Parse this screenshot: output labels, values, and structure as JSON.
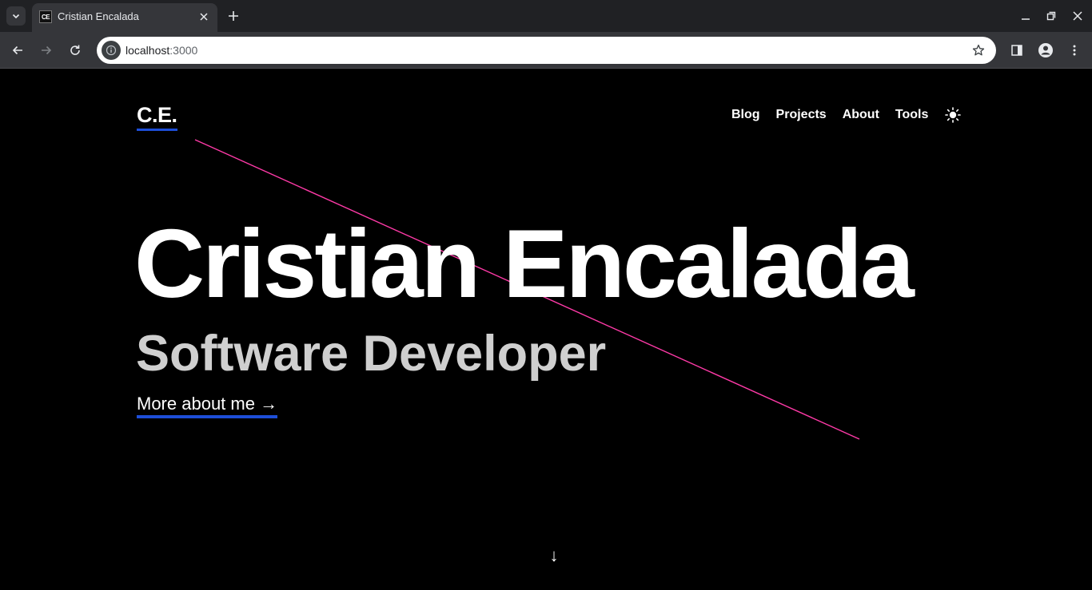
{
  "browser": {
    "tab": {
      "favicon_text": "CE",
      "title": "Cristian Encalada"
    },
    "address": {
      "host": "localhost",
      "port": ":3000"
    },
    "icons": {
      "tab_list": "chevron-down-icon",
      "tab_close": "close-icon",
      "new_tab": "plus-icon",
      "minimize": "minimize-icon",
      "restore": "restore-icon",
      "close_window": "close-icon",
      "back": "arrow-left-icon",
      "forward": "arrow-right-icon",
      "reload": "reload-icon",
      "site_info": "info-icon",
      "bookmark": "star-icon",
      "side_panel": "side-panel-icon",
      "profile": "profile-icon",
      "menu": "kebab-menu-icon"
    }
  },
  "page": {
    "logo": "C.E.",
    "nav": {
      "items": [
        {
          "label": "Blog"
        },
        {
          "label": "Projects"
        },
        {
          "label": "About"
        },
        {
          "label": "Tools"
        }
      ],
      "theme_toggle_icon": "sun-icon"
    },
    "hero": {
      "name": "Cristian Encalada",
      "role": "Software Developer",
      "cta": "More about me →"
    },
    "scroll_indicator": "↓",
    "colors": {
      "background": "#000000",
      "accent_underline": "#1d4ed8",
      "diagonal_line": "#ff3aa8",
      "text": "#ffffff",
      "subtitle": "#cfcfcf"
    }
  }
}
